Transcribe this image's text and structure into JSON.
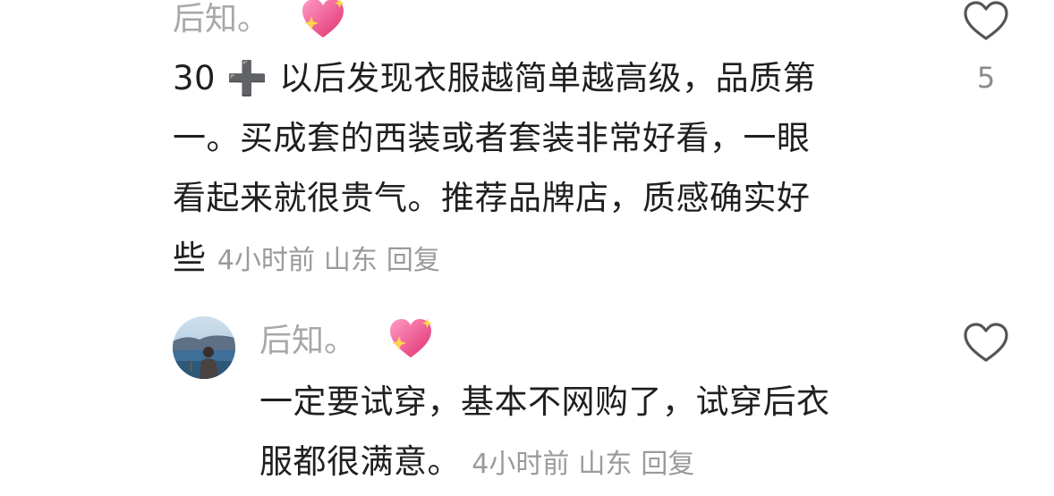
{
  "comments": [
    {
      "username": "后知。",
      "text_line1": "30 ➕ 以后发现衣服越简单越高级，品质第",
      "text_line2": "一。买成套的西装或者套装非常好看，一眼",
      "text_line3": "看起来就很贵气。推荐品牌店，质感确实好",
      "text_line4": "些",
      "time": "4小时前",
      "location": "山东",
      "reply_label": "回复",
      "like_count": "5",
      "emoji": "sparkling-heart-icon",
      "like_icon": "heart-outline-icon"
    },
    {
      "username": "后知。",
      "text_line1": "一定要试穿，基本不网购了，试穿后衣",
      "text_line2": "服都很满意。",
      "time": "4小时前",
      "location": "山东",
      "reply_label": "回复",
      "emoji": "sparkling-heart-icon",
      "like_icon": "heart-outline-icon"
    }
  ],
  "colors": {
    "username": "#a8a8a8",
    "text": "#1f1f1f",
    "meta": "#9a9a9a",
    "heart_emoji": "#e8457a"
  }
}
